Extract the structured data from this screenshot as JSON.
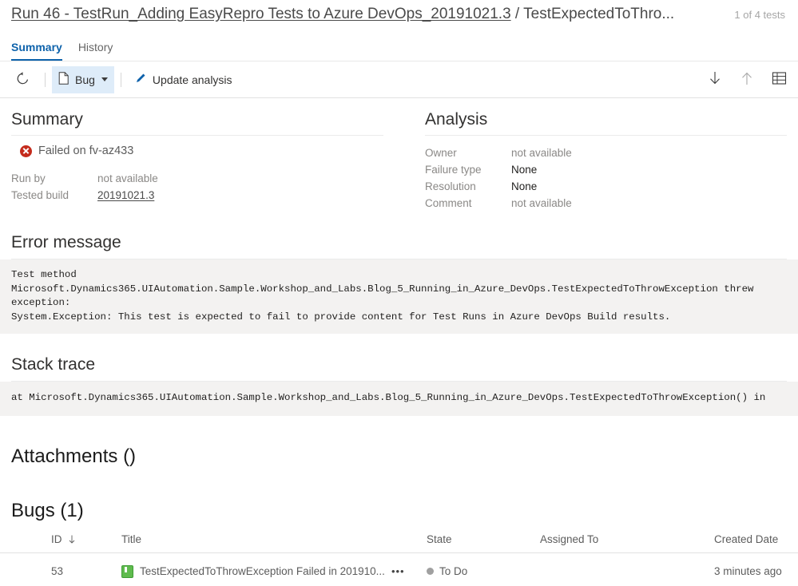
{
  "header": {
    "title_link": "Run 46 - TestRun_Adding EasyRepro Tests to Azure DevOps_20191021.3",
    "title_separator": " / ",
    "title_tail": "TestExpectedToThro...",
    "test_count": "1 of 4 tests"
  },
  "tabs": [
    {
      "label": "Summary",
      "active": true
    },
    {
      "label": "History",
      "active": false
    }
  ],
  "toolbar": {
    "refresh_icon": "refresh-icon",
    "bug_label": "Bug",
    "bug_icon": "file-icon",
    "update_analysis_label": "Update analysis",
    "update_analysis_icon": "pencil-icon",
    "next_icon": "arrow-down-icon",
    "previous_icon": "arrow-up-icon",
    "grid_icon": "table-grid-icon"
  },
  "summary": {
    "heading": "Summary",
    "status_text": "Failed on fv-az433",
    "status_icon": "error-circle-icon",
    "fields": [
      {
        "key": "Run by",
        "value": "not available",
        "link": false,
        "strong": false
      },
      {
        "key": "Tested build",
        "value": "20191021.3",
        "link": true,
        "strong": false
      }
    ]
  },
  "analysis": {
    "heading": "Analysis",
    "fields": [
      {
        "key": "Owner",
        "value": "not available",
        "strong": false
      },
      {
        "key": "Failure type",
        "value": "None",
        "strong": true
      },
      {
        "key": "Resolution",
        "value": "None",
        "strong": true
      },
      {
        "key": "Comment",
        "value": "not available",
        "strong": false
      }
    ]
  },
  "error_message": {
    "heading": "Error message",
    "body": "Test method\nMicrosoft.Dynamics365.UIAutomation.Sample.Workshop_and_Labs.Blog_5_Running_in_Azure_DevOps.TestExpectedToThrowException threw\nexception:\nSystem.Exception: This test is expected to fail to provide content for Test Runs in Azure DevOps Build results."
  },
  "stack_trace": {
    "heading": "Stack trace",
    "body": "at Microsoft.Dynamics365.UIAutomation.Sample.Workshop_and_Labs.Blog_5_Running_in_Azure_DevOps.TestExpectedToThrowException() in"
  },
  "attachments": {
    "heading": "Attachments ()"
  },
  "bugs": {
    "heading": "Bugs (1)",
    "columns": [
      "ID",
      "Title",
      "State",
      "Assigned To",
      "Created Date"
    ],
    "sort_column": "ID",
    "sort_icon": "arrow-down-icon",
    "rows": [
      {
        "id": "53",
        "title": "TestExpectedToThrowException Failed in 201910...",
        "title_icon": "bug-work-item-icon",
        "overflow": "•••",
        "state": "To Do",
        "assigned_to": "",
        "created_date": "3 minutes ago"
      }
    ]
  },
  "colors": {
    "accent": "#0d62ab",
    "error": "#c42b1c",
    "highlight": "#deecf9",
    "code_bg": "#f3f2f1",
    "bug_green": "#3f9c35"
  }
}
